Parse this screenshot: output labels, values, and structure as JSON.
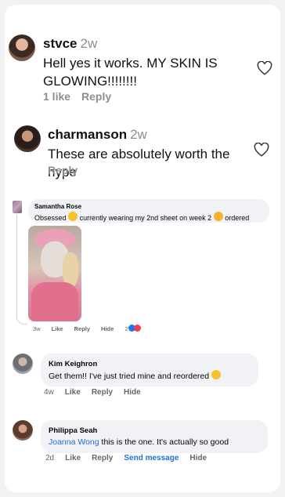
{
  "comments_ig": [
    {
      "username": "stvce",
      "time": "2w",
      "text_line1": "Hell yes it works. MY SKIN IS",
      "text_line2": "GLOWING!!!!!!!!",
      "likes": "1 like",
      "reply": "Reply",
      "like_icon": "heart-outline-icon"
    },
    {
      "username": "charmanson",
      "time": "2w",
      "text": "These are absolutely worth the hype",
      "reply": "Reply",
      "like_icon": "heart-outline-icon"
    }
  ],
  "comments_fb": [
    {
      "name": "Samantha Rose",
      "text_a": "Obsessed",
      "text_b": "currently wearing my 2nd sheet on week 2",
      "text_c": "ordered more",
      "actions": {
        "time": "3w",
        "like": "Like",
        "reply": "Reply",
        "hide": "Hide"
      },
      "reaction_count": "2",
      "reaction_icons": [
        "thumbs-up-icon",
        "heart-icon"
      ],
      "photo_icon": "face-mask-photo"
    },
    {
      "name": "Kim Keighron",
      "text": "Get them!! I've just tried mine and reordered",
      "emoji_icon": "laughing-face-icon",
      "actions": {
        "time": "4w",
        "like": "Like",
        "reply": "Reply",
        "hide": "Hide"
      }
    },
    {
      "name": "Philippa Seah",
      "mention": "Joanna Wong",
      "text": "this is the one. It's actually so good",
      "actions": {
        "time": "2d",
        "like": "Like",
        "reply": "Reply",
        "send": "Send message",
        "hide": "Hide"
      }
    }
  ],
  "colors": {
    "link_blue": "#216fdb",
    "bubble_bg": "#f0f2f5",
    "muted": "#8e8e8e"
  }
}
